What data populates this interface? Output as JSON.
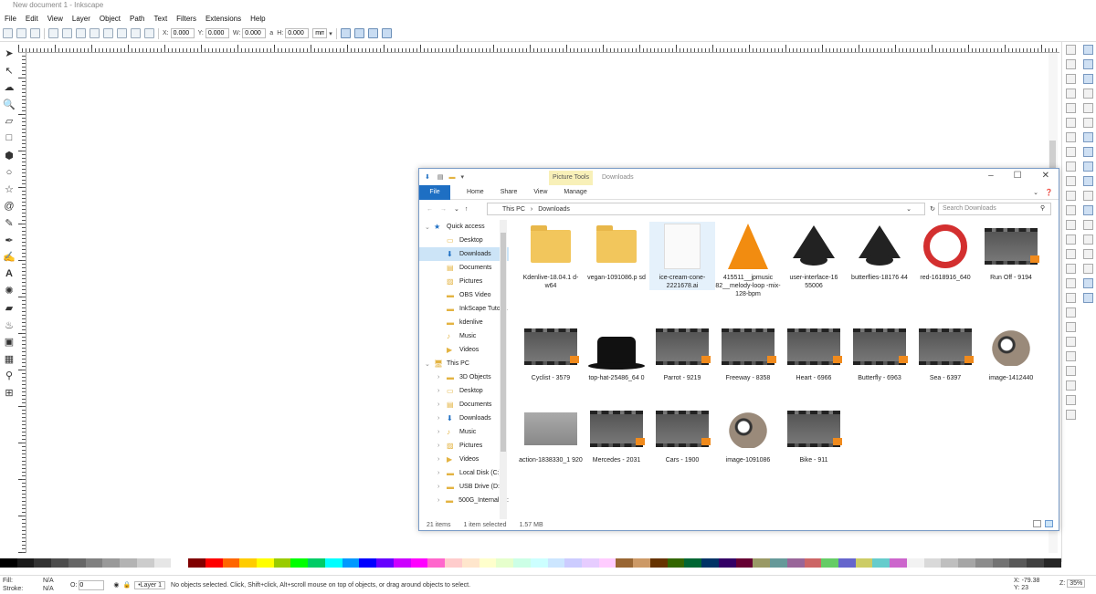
{
  "window": {
    "title": "New document 1 - Inkscape"
  },
  "menu": [
    "File",
    "Edit",
    "View",
    "Layer",
    "Object",
    "Path",
    "Text",
    "Filters",
    "Extensions",
    "Help"
  ],
  "controls": {
    "x_label": "X:",
    "x_value": "0.000",
    "y_label": "Y:",
    "y_value": "0.000",
    "w_label": "W:",
    "w_value": "0.000",
    "h_label": "H:",
    "h_value": "0.000",
    "unit": "mm"
  },
  "status": {
    "fill_label": "Fill:",
    "fill_value": "N/A",
    "stroke_label": "Stroke:",
    "stroke_value": "N/A",
    "opacity_label": "O:",
    "opacity_value": "0",
    "layer": "•Layer 1",
    "message": "No objects selected. Click, Shift+click, Alt+scroll mouse on top of objects, or drag around objects to select.",
    "coord_x_label": "X:",
    "coord_x": "-79.38",
    "coord_y_label": "Y:",
    "coord_y": "23",
    "zoom_label": "Z:",
    "zoom": "35%"
  },
  "palette_colors": [
    "#000000",
    "#1a1a1a",
    "#333333",
    "#4d4d4d",
    "#666666",
    "#808080",
    "#999999",
    "#b3b3b3",
    "#cccccc",
    "#e6e6e6",
    "#ffffff",
    "#800000",
    "#ff0000",
    "#ff6600",
    "#ffcc00",
    "#ffff00",
    "#99cc00",
    "#00ff00",
    "#00cc66",
    "#00ffff",
    "#0099ff",
    "#0000ff",
    "#6600ff",
    "#cc00ff",
    "#ff00ff",
    "#ff66cc",
    "#ffcccc",
    "#ffe6cc",
    "#ffffcc",
    "#e6ffcc",
    "#ccffe6",
    "#ccffff",
    "#cce6ff",
    "#ccccff",
    "#e6ccff",
    "#ffccff",
    "#996633",
    "#cc9966",
    "#663300",
    "#336600",
    "#006633",
    "#003366",
    "#330066",
    "#660033",
    "#999966",
    "#669999",
    "#996699",
    "#cc6666",
    "#66cc66",
    "#6666cc",
    "#cccc66",
    "#66cccc",
    "#cc66cc",
    "#f2f2f2",
    "#d9d9d9",
    "#bfbfbf",
    "#a6a6a6",
    "#8c8c8c",
    "#737373",
    "#595959",
    "#404040",
    "#262626"
  ],
  "explorer": {
    "context_tab": "Picture Tools",
    "title": "Downloads",
    "ribbon": {
      "file": "File",
      "tabs": [
        "Home",
        "Share",
        "View",
        "Manage"
      ]
    },
    "path": [
      "This PC",
      "Downloads"
    ],
    "search_placeholder": "Search Downloads",
    "nav": [
      {
        "label": "Quick access",
        "level": 0
      },
      {
        "label": "Desktop",
        "level": 1
      },
      {
        "label": "Downloads",
        "level": 1,
        "selected": true
      },
      {
        "label": "Documents",
        "level": 1
      },
      {
        "label": "Pictures",
        "level": 1
      },
      {
        "label": "OBS Video",
        "level": 1
      },
      {
        "label": "InkScape Tutoria",
        "level": 1
      },
      {
        "label": "kdenlive",
        "level": 1
      },
      {
        "label": "Music",
        "level": 1
      },
      {
        "label": "Videos",
        "level": 1
      },
      {
        "label": "This PC",
        "level": 0
      },
      {
        "label": "3D Objects",
        "level": 1
      },
      {
        "label": "Desktop",
        "level": 1
      },
      {
        "label": "Documents",
        "level": 1
      },
      {
        "label": "Downloads",
        "level": 1
      },
      {
        "label": "Music",
        "level": 1
      },
      {
        "label": "Pictures",
        "level": 1
      },
      {
        "label": "Videos",
        "level": 1
      },
      {
        "label": "Local Disk (C:)",
        "level": 1
      },
      {
        "label": "USB Drive (D:)",
        "level": 1
      },
      {
        "label": "500G_Internal (F:",
        "level": 1
      }
    ],
    "files": [
      {
        "name": "Kdenlive-18.04.1 d-w64",
        "type": "folder"
      },
      {
        "name": "vegan-1091086.p sd",
        "type": "folder-gimp"
      },
      {
        "name": "ice-cream-cone-2221678.ai",
        "type": "doc"
      },
      {
        "name": "415511__jpmusic 82__melody-loop -mix-128-bpm",
        "type": "cone"
      },
      {
        "name": "user-interface-16 55006",
        "type": "ink"
      },
      {
        "name": "butterflies-18176 44",
        "type": "ink"
      },
      {
        "name": "red-1618916_640",
        "type": "ring"
      },
      {
        "name": "Run Off - 9194",
        "type": "video"
      },
      {
        "name": "Cyclist - 3579",
        "type": "video"
      },
      {
        "name": "top-hat-25486_64 0",
        "type": "hat"
      },
      {
        "name": "Parrot - 9219",
        "type": "video"
      },
      {
        "name": "Freeway - 8358",
        "type": "video"
      },
      {
        "name": "Heart - 6966",
        "type": "video"
      },
      {
        "name": "Butterfly - 6963",
        "type": "video"
      },
      {
        "name": "Sea - 6397",
        "type": "video"
      },
      {
        "name": "image-1412440",
        "type": "gimp"
      },
      {
        "name": "action-1838330_1 920",
        "type": "photo"
      },
      {
        "name": "Mercedes - 2031",
        "type": "video"
      },
      {
        "name": "Cars - 1900",
        "type": "video"
      },
      {
        "name": "image-1091086",
        "type": "gimp"
      },
      {
        "name": "Bike - 911",
        "type": "video"
      }
    ],
    "status_count": "21 items",
    "status_selected": "1 item selected",
    "status_size": "1.57 MB"
  }
}
